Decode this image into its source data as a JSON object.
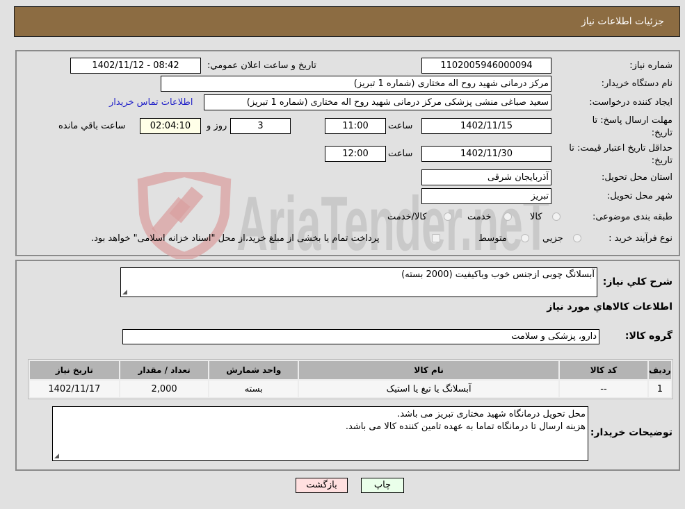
{
  "header": {
    "title": "جزئیات اطلاعات نیاز"
  },
  "watermark": {
    "text": "AriaTender.neT",
    "colors": {
      "shield": "#d9a0a0",
      "text": "#c4c4c4"
    }
  },
  "details": {
    "need_number": {
      "label": "شماره نیاز:",
      "value": "1102005946000094"
    },
    "announce_datetime": {
      "label": "تاریخ و ساعت اعلان عمومي:",
      "value": "1402/11/12 - 08:42"
    },
    "buyer_org": {
      "label": "نام دستگاه خريدار:",
      "value": "مرکز درمانی شهید روح اله مختاری (شماره 1 تبریز)"
    },
    "requester": {
      "label": "ایجاد کننده درخواست:",
      "value": "سعید صباغی منشی  پزشکی مرکز درمانی شهید روح اله مختاری (شماره 1 تبریز)",
      "contact_link": "اطلاعات تماس خریدار"
    },
    "reply_deadline": {
      "label": "مهلت ارسال پاسخ: تا تاریخ:",
      "date": "1402/11/15",
      "time_label": "ساعت",
      "time": "11:00",
      "days": "3",
      "days_label": "روز و",
      "remaining": "02:04:10",
      "remaining_label": "ساعت باقي مانده"
    },
    "price_validity": {
      "label": "حداقل تاریخ اعتبار قیمت: تا تاریخ:",
      "date": "1402/11/30",
      "time_label": "ساعت",
      "time": "12:00"
    },
    "province": {
      "label": "استان محل تحویل:",
      "value": "آذربایجان شرقی"
    },
    "city": {
      "label": "شهر محل تحویل:",
      "value": "تبریز"
    },
    "category": {
      "label": "طبقه بندی موضوعی:",
      "options": [
        "کالا",
        "خدمت",
        "کالا/خدمت"
      ]
    },
    "purchase_type": {
      "label": "نوع فرآیند خرید :",
      "options": [
        "جزيي",
        "متوسط"
      ],
      "note": "پرداخت تمام یا بخشی از مبلغ خرید،از محل \"اسناد خزانه اسلامی\" خواهد بود."
    }
  },
  "description": {
    "label": "شرح كلي نياز:",
    "value": "آبسلانگ چوبی ازجنس خوب وباکیفیت (2000 بسته)"
  },
  "goods_section_title": "اطلاعات كالاهاي مورد نياز",
  "goods_group": {
    "label": "گروه کالا:",
    "value": "دارو، پزشکی و سلامت"
  },
  "items_table": {
    "columns": [
      "ردیف",
      "کد کالا",
      "نام کالا",
      "واحد شمارش",
      "تعداد / مقدار",
      "تاریخ نیاز"
    ],
    "rows": [
      [
        "1",
        "--",
        "آبسلانگ یا تیغ یا استیک",
        "بسته",
        "2,000",
        "1402/11/17"
      ]
    ]
  },
  "buyer_notes": {
    "label": "توضیحات خریدار:",
    "lines": [
      "محل تحویل درمانگاه شهید مختاری تبریز می باشد.",
      "هزینه ارسال تا درمانگاه تماما به عهده تامین کننده کالا می باشد."
    ]
  },
  "buttons": {
    "print": "چاپ",
    "back": "بازگشت"
  }
}
